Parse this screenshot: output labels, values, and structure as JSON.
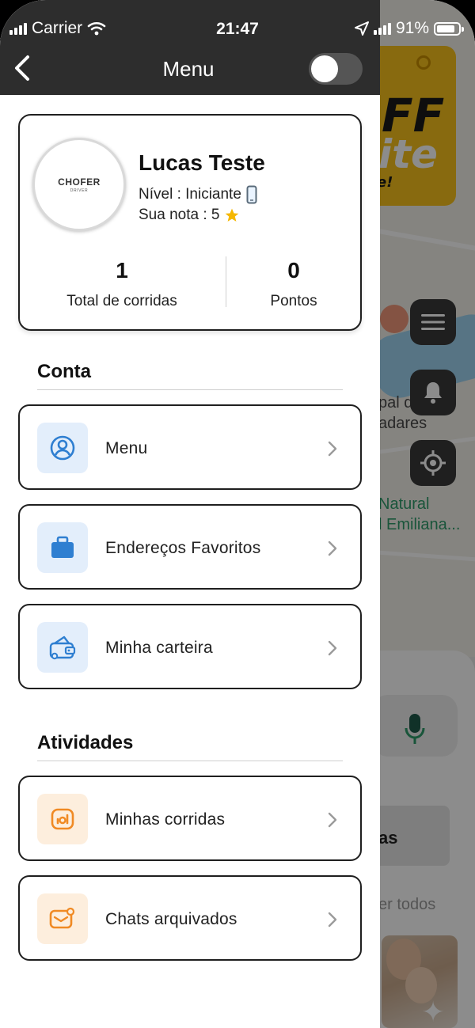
{
  "status_bar": {
    "carrier": "Carrier",
    "time": "21:47",
    "battery": "91%"
  },
  "header": {
    "title": "Menu",
    "toggle_on": false
  },
  "profile": {
    "logo_text": "CHOFER",
    "logo_subtext": "DRIVER",
    "name": "Lucas Teste",
    "level": "Nível : Iniciante",
    "rating": "Sua nota : 5",
    "stats": [
      {
        "value": "1",
        "label": "Total de corridas"
      },
      {
        "value": "0",
        "label": "Pontos"
      }
    ]
  },
  "sections": [
    {
      "title": "Conta",
      "items": [
        {
          "label": "Menu",
          "icon": "user-circle-icon"
        },
        {
          "label": "Endereços Favoritos",
          "icon": "briefcase-icon"
        },
        {
          "label": "Minha carteira",
          "icon": "wallet-icon"
        }
      ]
    },
    {
      "title": "Atividades",
      "items": [
        {
          "label": "Minhas corridas",
          "icon": "rides-icon"
        },
        {
          "label": "Chats arquivados",
          "icon": "archived-chat-icon"
        }
      ]
    }
  ],
  "background": {
    "promo_line1": "FF",
    "promo_line2": "ite",
    "promo_line3": "e!",
    "map_label_1a": "pal de",
    "map_label_1b": "adares",
    "map_label_2a": "Natural",
    "map_label_2b": "l Emiliana...",
    "sheet_box_text": "as",
    "see_all": "er todos"
  },
  "colors": {
    "header_bg": "#2d2d2d",
    "icon_blue": "#2f7fd1",
    "icon_blue_bg": "#e3eefb",
    "icon_orange": "#f08a24",
    "icon_orange_bg": "#fdeedd",
    "star": "#f5b700",
    "map_green": "#2e9b6b"
  }
}
